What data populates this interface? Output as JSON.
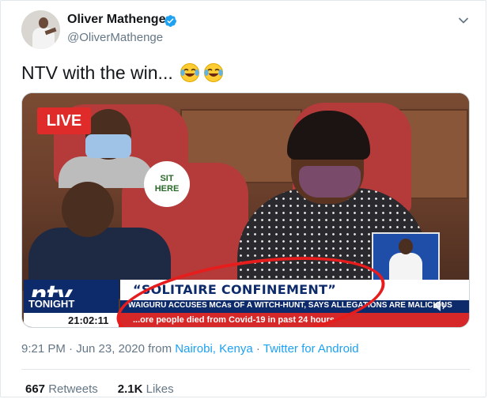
{
  "author": {
    "name": "Oliver Mathenge",
    "handle": "@OliverMathenge",
    "verified": true
  },
  "tweet": {
    "text": "NTV with the win...",
    "emojis": [
      "face-with-tears-of-joy-icon",
      "face-with-tears-of-joy-icon"
    ]
  },
  "media": {
    "live_badge": "LIVE",
    "sign_line1": "SIT",
    "sign_line2": "HERE",
    "channel_logo": "ntv",
    "show_name": "TONIGHT",
    "headline": "“SOLITAIRE CONFINEMENT”",
    "subheadline": "WAIGURU ACCUSES MCAs OF A WITCH-HUNT, SAYS ALLEGATIONS ARE MALICIOUS",
    "clock": "21:02:11",
    "ticker": "...ore people died from Covid-19 in past 24 hours"
  },
  "meta": {
    "time": "9:21 PM · Jun 23, 2020 from ",
    "location": "Nairobi, Kenya",
    "separator": " · ",
    "source": "Twitter for Android"
  },
  "stats": {
    "retweets_count": "667",
    "retweets_label": "Retweets",
    "likes_count": "2.1K",
    "likes_label": "Likes"
  },
  "colors": {
    "accent": "#1da1f2",
    "live": "#e02b2b",
    "ntv_blue": "#0d2b6b"
  }
}
